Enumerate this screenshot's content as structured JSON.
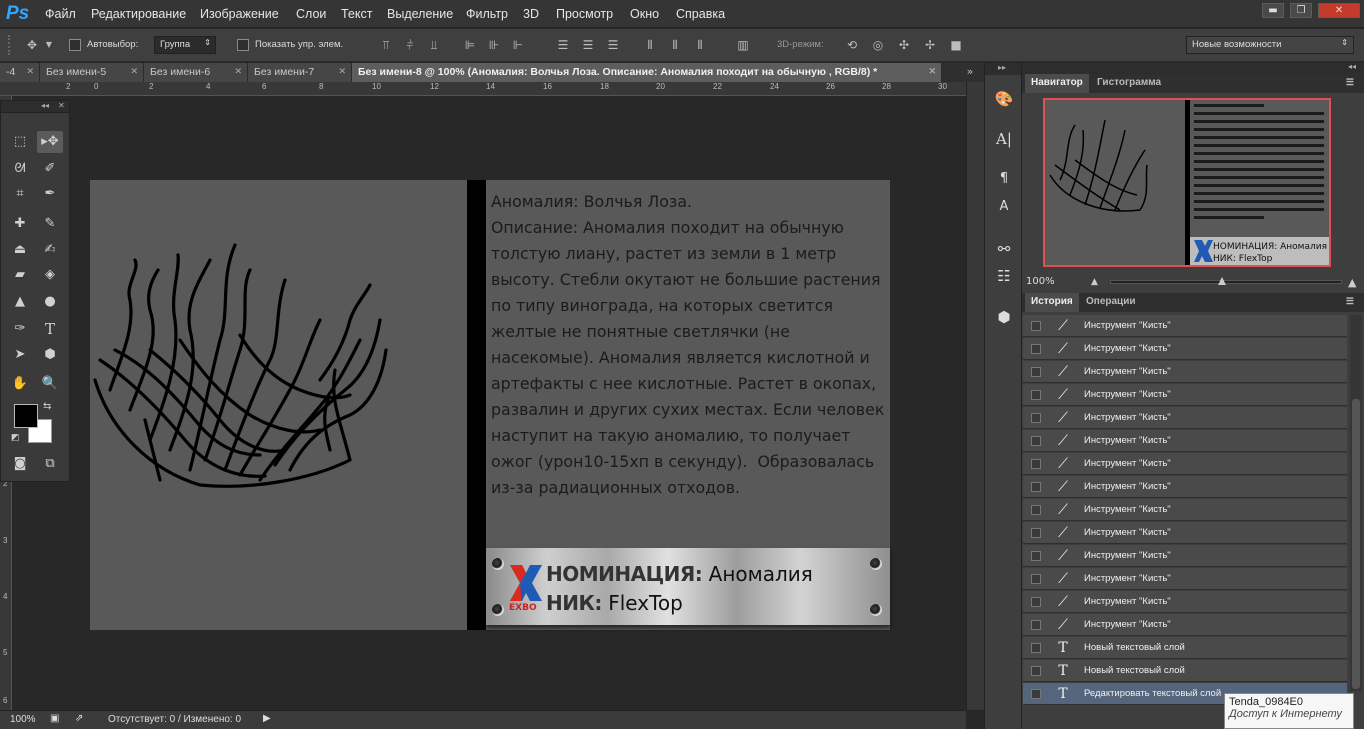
{
  "app": {
    "logo": "Ps"
  },
  "menu": [
    "Файл",
    "Редактирование",
    "Изображение",
    "Слои",
    "Текст",
    "Выделение",
    "Фильтр",
    "3D",
    "Просмотр",
    "Окно",
    "Справка"
  ],
  "window_controls": {
    "minimize": "▬",
    "restore": "❐",
    "close": "✕"
  },
  "options": {
    "autoselect_label": "Автовыбор:",
    "autoselect_value": "Группа",
    "show_controls_label": "Показать упр. элем.",
    "mode3d_label": "3D-режим:",
    "workspace_value": "Новые возможности"
  },
  "doc_tabs": [
    {
      "label": "-4"
    },
    {
      "label": "Без имени-5"
    },
    {
      "label": "Без имени-6"
    },
    {
      "label": "Без имени-7"
    },
    {
      "label": "Без имени-8 @ 100% (Аномалия: Волчья Лоза.  Описание: Аномалия походит на обычную  , RGB/8) *"
    }
  ],
  "ruler_top_labels": [
    "2",
    "0",
    "2",
    "4",
    "6",
    "8",
    "10",
    "12",
    "14",
    "16",
    "18",
    "20",
    "22",
    "24",
    "26",
    "28",
    "30"
  ],
  "ruler_left_labels": [
    "0",
    "1",
    "2",
    "3",
    "4",
    "5",
    "6",
    "7"
  ],
  "document": {
    "text": "Аномалия: Волчья Лоза.\nОписание: Аномалия походит на обычную толстую лиану, растет из земли в 1 метр высоту. Стебли окутают не большие растения по типу винограда, на которых светится желтые не понятные светлячки (не насекомые). Аномалия является кислотной и артефакты с нее кислотные. Растет в окопах, развалин и других сухих местах. Если человек наступит на такую аномалию, то получает ожог (урон10-15хп в секунду).  Образовалась из-за радиационных отходов.",
    "plate_line1_key": "НОМИНАЦИЯ:",
    "plate_line1_value": "Аномалия",
    "plate_line2_key": "НИК:",
    "plate_line2_value": "FlexTop",
    "logo_text": "EXBO"
  },
  "status": {
    "zoom": "100%",
    "info": "Отсутствует: 0 / Изменено: 0"
  },
  "navigator": {
    "tab_active": "Навигатор",
    "tab_other": "Гистограмма",
    "zoom": "100%",
    "zoom_level": 0.48
  },
  "history": {
    "tab_active": "История",
    "tab_other": "Операции",
    "items": [
      {
        "icon": "brush",
        "label": "Инструмент \"Кисть\""
      },
      {
        "icon": "brush",
        "label": "Инструмент \"Кисть\""
      },
      {
        "icon": "brush",
        "label": "Инструмент \"Кисть\""
      },
      {
        "icon": "brush",
        "label": "Инструмент \"Кисть\""
      },
      {
        "icon": "brush",
        "label": "Инструмент \"Кисть\""
      },
      {
        "icon": "brush",
        "label": "Инструмент \"Кисть\""
      },
      {
        "icon": "brush",
        "label": "Инструмент \"Кисть\""
      },
      {
        "icon": "brush",
        "label": "Инструмент \"Кисть\""
      },
      {
        "icon": "brush",
        "label": "Инструмент \"Кисть\""
      },
      {
        "icon": "brush",
        "label": "Инструмент \"Кисть\""
      },
      {
        "icon": "brush",
        "label": "Инструмент \"Кисть\""
      },
      {
        "icon": "brush",
        "label": "Инструмент \"Кисть\""
      },
      {
        "icon": "brush",
        "label": "Инструмент \"Кисть\""
      },
      {
        "icon": "brush",
        "label": "Инструмент \"Кисть\""
      },
      {
        "icon": "text",
        "label": "Новый текстовый слой"
      },
      {
        "icon": "text",
        "label": "Новый текстовый слой"
      },
      {
        "icon": "text",
        "label": "Редактировать текстовый слой"
      }
    ]
  },
  "tooltip": {
    "line1": "Tenda_0984E0",
    "line2": "Доступ к Интернету"
  },
  "colors": {
    "accent": "#31a8ff",
    "nav_frame": "#e05050",
    "history_selected": "#55657c"
  }
}
